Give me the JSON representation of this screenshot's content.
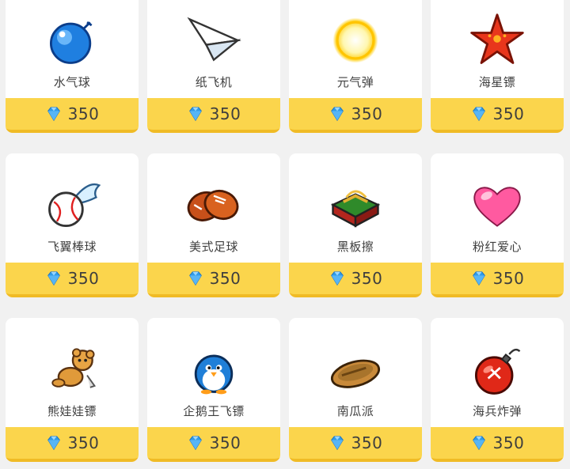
{
  "items": [
    {
      "name": "水气球",
      "price": "350",
      "icon": "water-balloon-icon"
    },
    {
      "name": "纸飞机",
      "price": "350",
      "icon": "paper-plane-icon"
    },
    {
      "name": "元气弹",
      "price": "350",
      "icon": "energy-ball-icon"
    },
    {
      "name": "海星镖",
      "price": "350",
      "icon": "starfish-dart-icon"
    },
    {
      "name": "飞翼棒球",
      "price": "350",
      "icon": "winged-baseball-icon"
    },
    {
      "name": "美式足球",
      "price": "350",
      "icon": "american-football-icon"
    },
    {
      "name": "黑板擦",
      "price": "350",
      "icon": "blackboard-eraser-icon"
    },
    {
      "name": "粉红爱心",
      "price": "350",
      "icon": "pink-heart-icon"
    },
    {
      "name": "熊娃娃镖",
      "price": "350",
      "icon": "teddy-bear-dart-icon"
    },
    {
      "name": "企鹅王飞镖",
      "price": "350",
      "icon": "penguin-king-dart-icon"
    },
    {
      "name": "南瓜派",
      "price": "350",
      "icon": "pumpkin-pie-icon"
    },
    {
      "name": "海兵炸弹",
      "price": "350",
      "icon": "marine-bomb-icon"
    }
  ],
  "currency_icon": "diamond-gem-icon",
  "colors": {
    "price_bar": "#fbd54c",
    "price_bar_edge": "#f0bb25",
    "background": "#f1f1f1",
    "gem": "#2f9be8"
  }
}
